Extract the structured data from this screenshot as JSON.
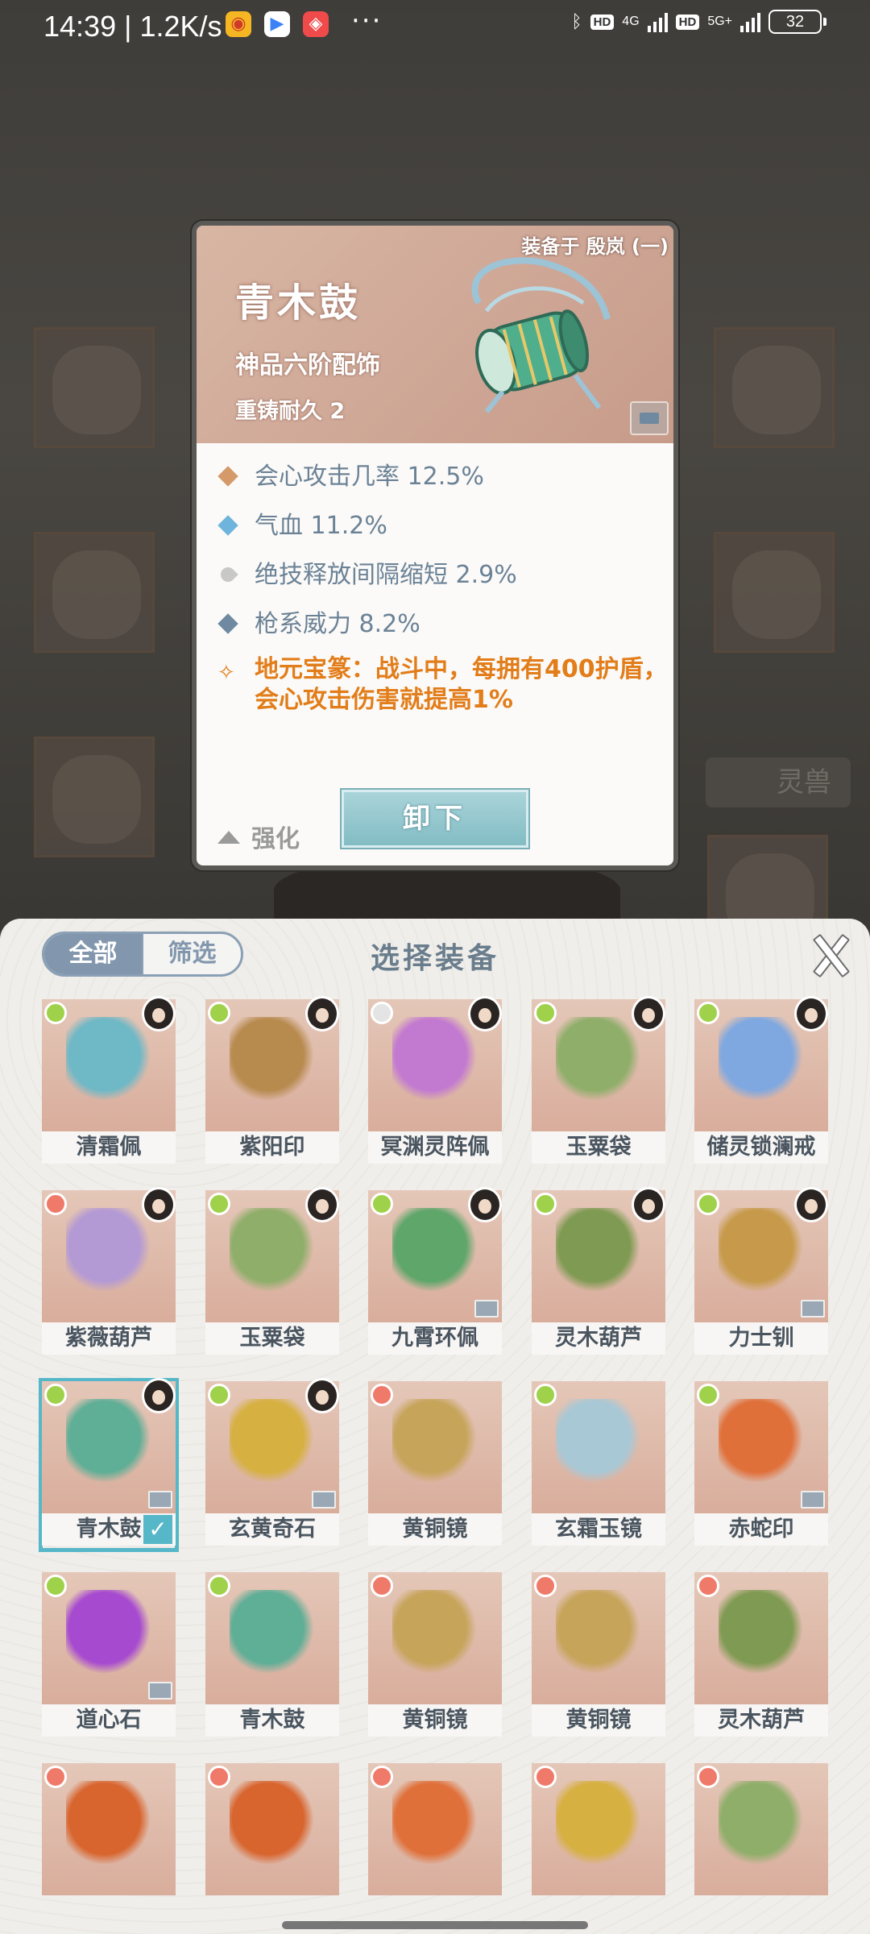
{
  "status_bar": {
    "time": "14:39 | 1.2K/s",
    "network_1": "4G",
    "network_2": "5G+",
    "hd_1": "HD",
    "hd_2": "HD",
    "battery": "32",
    "more": "···"
  },
  "background": {
    "beast_tab_label": "灵兽"
  },
  "detail": {
    "equipped_by": "装备于 殷岚 (一)",
    "name": "青木鼓",
    "grade": "神品六阶配饰",
    "reforge": "重铸耐久 2",
    "stats": [
      {
        "text": "会心攻击几率 12.5%",
        "color": "#d49a6a"
      },
      {
        "text": "气血 11.2%",
        "color": "#6fb4dc"
      },
      {
        "text": "绝技释放间隔缩短 2.9%",
        "color": "#b8b8b8"
      },
      {
        "text": "枪系威力 8.2%",
        "color": "#6f8aa0"
      }
    ],
    "special": "地元宝篆：战斗中，每拥有400护盾，会心攻击伤害就提高1%",
    "enhance_label": "强化",
    "unload_label": "卸下"
  },
  "sheet": {
    "tab_all": "全部",
    "tab_filter": "筛选",
    "title": "选择装备",
    "items": [
      {
        "label": "清霜佩",
        "element": "#9fd24a",
        "avatar": true,
        "chest": false,
        "obj": "#6fb8c6",
        "selected": false
      },
      {
        "label": "紫阳印",
        "element": "#9fd24a",
        "avatar": true,
        "chest": false,
        "obj": "#b78a4e",
        "selected": false
      },
      {
        "label": "冥渊灵阵佩",
        "element": "#e4e4e4",
        "avatar": true,
        "chest": false,
        "obj": "#c27ad0",
        "selected": false
      },
      {
        "label": "玉粟袋",
        "element": "#9fd24a",
        "avatar": true,
        "chest": false,
        "obj": "#8fae6a",
        "selected": false
      },
      {
        "label": "储灵锁澜戒",
        "element": "#9fd24a",
        "avatar": true,
        "chest": false,
        "obj": "#7fa8e0",
        "selected": false
      },
      {
        "label": "紫薇葫芦",
        "element": "#f07a6a",
        "avatar": true,
        "chest": false,
        "obj": "#b49ad4",
        "selected": false
      },
      {
        "label": "玉粟袋",
        "element": "#9fd24a",
        "avatar": true,
        "chest": false,
        "obj": "#8fae6a",
        "selected": false
      },
      {
        "label": "九霄环佩",
        "element": "#9fd24a",
        "avatar": true,
        "chest": true,
        "obj": "#5fa66a",
        "selected": false
      },
      {
        "label": "灵木葫芦",
        "element": "#9fd24a",
        "avatar": true,
        "chest": false,
        "obj": "#7f9a52",
        "selected": false
      },
      {
        "label": "力士钏",
        "element": "#9fd24a",
        "avatar": true,
        "chest": true,
        "obj": "#c69a4a",
        "selected": false
      },
      {
        "label": "青木鼓",
        "element": "#9fd24a",
        "avatar": true,
        "chest": true,
        "obj": "#5fae96",
        "selected": true
      },
      {
        "label": "玄黄奇石",
        "element": "#9fd24a",
        "avatar": true,
        "chest": true,
        "obj": "#d6b040",
        "selected": false
      },
      {
        "label": "黄铜镜",
        "element": "#f07a6a",
        "avatar": false,
        "chest": false,
        "obj": "#c6a45a",
        "selected": false
      },
      {
        "label": "玄霜玉镜",
        "element": "#9fd24a",
        "avatar": false,
        "chest": false,
        "obj": "#a8c8d6",
        "selected": false
      },
      {
        "label": "赤蛇印",
        "element": "#9fd24a",
        "avatar": false,
        "chest": true,
        "obj": "#e0703a",
        "selected": false
      },
      {
        "label": "道心石",
        "element": "#9fd24a",
        "avatar": false,
        "chest": true,
        "obj": "#a64ad0",
        "selected": false
      },
      {
        "label": "青木鼓",
        "element": "#9fd24a",
        "avatar": false,
        "chest": false,
        "obj": "#5fae96",
        "selected": false
      },
      {
        "label": "黄铜镜",
        "element": "#f07a6a",
        "avatar": false,
        "chest": false,
        "obj": "#c6a45a",
        "selected": false
      },
      {
        "label": "黄铜镜",
        "element": "#f07a6a",
        "avatar": false,
        "chest": false,
        "obj": "#c6a45a",
        "selected": false
      },
      {
        "label": "灵木葫芦",
        "element": "#f07a6a",
        "avatar": false,
        "chest": false,
        "obj": "#7f9a52",
        "selected": false
      },
      {
        "label": "",
        "element": "#f07a6a",
        "avatar": false,
        "chest": false,
        "obj": "#d8642e",
        "selected": false
      },
      {
        "label": "",
        "element": "#f07a6a",
        "avatar": false,
        "chest": false,
        "obj": "#d8642e",
        "selected": false
      },
      {
        "label": "",
        "element": "#f07a6a",
        "avatar": false,
        "chest": false,
        "obj": "#e0703a",
        "selected": false
      },
      {
        "label": "",
        "element": "#f07a6a",
        "avatar": false,
        "chest": false,
        "obj": "#d6b040",
        "selected": false
      },
      {
        "label": "",
        "element": "#f07a6a",
        "avatar": false,
        "chest": false,
        "obj": "#8fae6a",
        "selected": false
      }
    ]
  }
}
